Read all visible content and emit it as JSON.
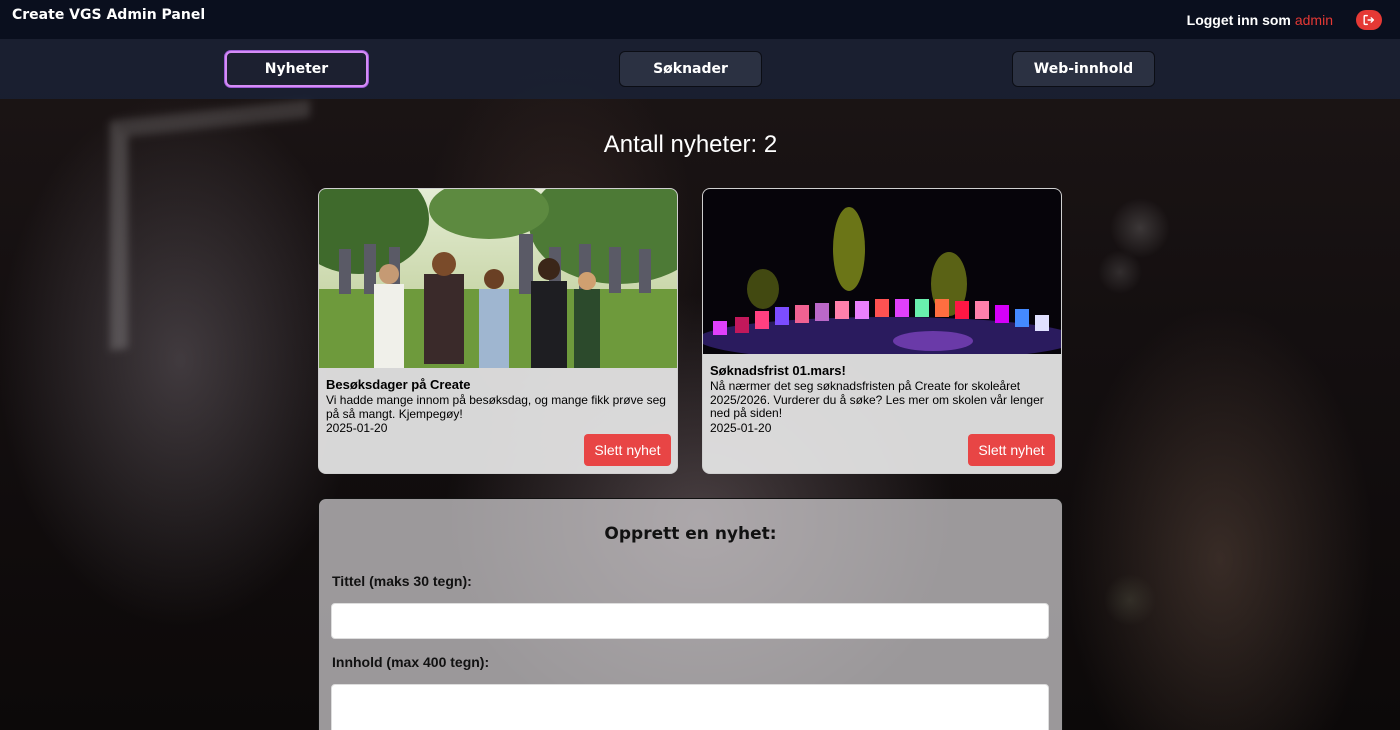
{
  "header": {
    "app_title": "Create VGS Admin Panel",
    "logged_in_label": "Logget inn som",
    "username": "admin",
    "logout_icon": "logout-icon"
  },
  "nav": {
    "tabs": [
      {
        "label": "Nyheter",
        "active": true
      },
      {
        "label": "Søknader",
        "active": false
      },
      {
        "label": "Web-innhold",
        "active": false
      }
    ]
  },
  "main": {
    "count_title": "Antall nyheter: 2",
    "news": [
      {
        "title": "Besøksdager på Create",
        "text": "Vi hadde mange innom på besøksdag, og mange fikk prøve seg på så mangt. Kjempegøy!",
        "date": "2025-01-20",
        "delete_label": "Slett nyhet"
      },
      {
        "title": "Søknadsfrist 01.mars!",
        "text": "Nå nærmer det seg søknadsfristen på Create for skoleåret 2025/2026. Vurderer du å søke? Les mer om skolen vår lenger ned på siden!",
        "date": "2025-01-20",
        "delete_label": "Slett nyhet"
      }
    ]
  },
  "form": {
    "title": "Opprett en nyhet:",
    "title_label": "Tittel (maks 30 tegn):",
    "title_value": "",
    "content_label": "Innhold (max 400 tegn):",
    "content_value": ""
  },
  "colors": {
    "accent_red": "#e53935",
    "active_tab_border": "#d58cf5",
    "topbar_bg": "#0a0f1e"
  }
}
